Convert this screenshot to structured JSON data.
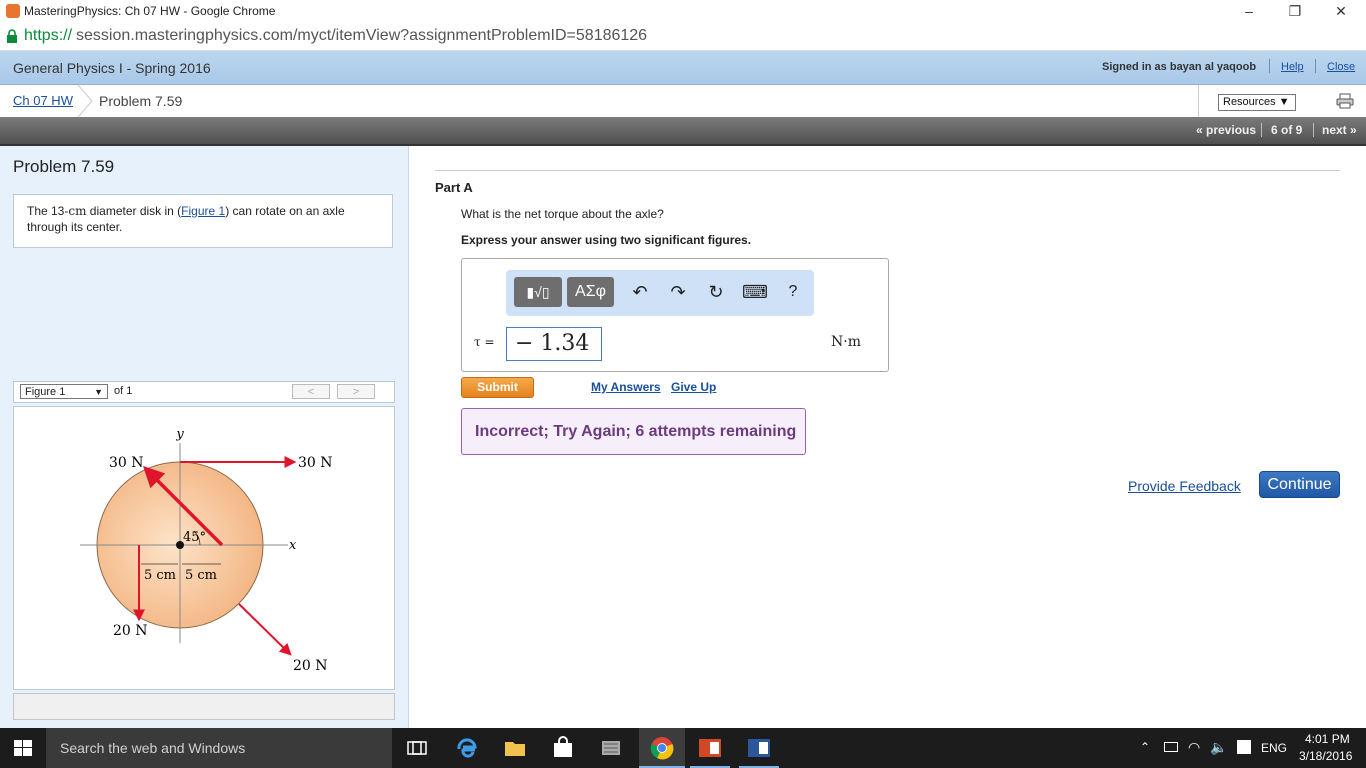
{
  "browser": {
    "window_title": "MasteringPhysics: Ch 07 HW - Google Chrome",
    "url_scheme": "https://",
    "url_rest": "session.masteringphysics.com/myct/itemView?assignmentProblemID=58186126",
    "minimize": "–",
    "restore": "❐",
    "close": "✕"
  },
  "header": {
    "course": "General Physics I - Spring 2016",
    "signed_in": "Signed in as bayan al yaqoob",
    "help": "Help",
    "close": "Close"
  },
  "breadcrumb": {
    "assignment": "Ch 07 HW",
    "problem": "Problem 7.59",
    "resources": "Resources ▼"
  },
  "nav": {
    "previous": "« previous",
    "position": "6 of 9",
    "next": "next »"
  },
  "problem": {
    "title": "Problem 7.59",
    "text_before": "The 13-",
    "text_unit": "cm",
    "text_mid": " diameter disk in (",
    "figure_link": "Figure 1",
    "text_after": ") can rotate on an axle through its center."
  },
  "figure": {
    "selector": "Figure 1",
    "of": "of 1",
    "prev": "<",
    "next": ">",
    "labels": {
      "y_axis": "y",
      "x_axis": "x",
      "force_top_left": "30 N",
      "force_top_right": "30 N",
      "force_bottom_left": "20 N",
      "force_bottom_right": "20 N",
      "angle": "45°",
      "dist_left": "5 cm",
      "dist_right": "5 cm"
    }
  },
  "part": {
    "label": "Part A",
    "question": "What is the net torque about the axle?",
    "instruction": "Express your answer using two significant figures.",
    "toolbar": {
      "templates": "▮√▯",
      "symbols": "ΑΣφ",
      "undo": "↶",
      "redo": "↷",
      "reset": "↻",
      "keyboard": "⌨",
      "help": "?"
    },
    "variable": "τ =",
    "answer": "− 1.34",
    "units": "N·m",
    "submit": "Submit",
    "my_answers": "My Answers",
    "give_up": "Give Up",
    "feedback": "Incorrect; Try Again; 6 attempts remaining"
  },
  "footer": {
    "provide_feedback": "Provide Feedback",
    "continue": "Continue"
  },
  "taskbar": {
    "search": "Search the web and Windows",
    "language": "ENG",
    "time": "4:01 PM",
    "date": "3/18/2016"
  },
  "colors": {
    "disk_fill": "#f6c79c",
    "force_arrow": "#e0142b",
    "course_bar": "#b4d1ec",
    "feedback_bg": "#f7eefc",
    "submit": "#ef9530",
    "continue": "#2a66b4"
  }
}
